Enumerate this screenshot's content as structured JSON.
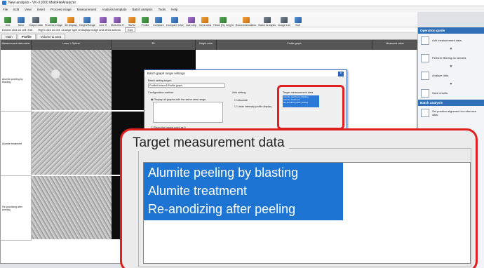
{
  "window": {
    "title": "New analysis - VK-X1000 MultiFileAnalyzer"
  },
  "menu": [
    "File",
    "Edit",
    "View",
    "Insert",
    "Process image",
    "Measurement",
    "Analysis template",
    "Batch analysis",
    "Tools",
    "Help"
  ],
  "ribbon": [
    "Add",
    "Save",
    "Output data",
    "Process image",
    "3D display",
    "Height/Range",
    "Line R",
    "Multi-line R",
    "Sa/Sz",
    "Profile",
    "Compare",
    "Compare CAD",
    "Ave step",
    "Vol & area",
    "Plane (R), height",
    "Recommendation",
    "Batch Analysis",
    "Image List",
    "Sort"
  ],
  "hints": {
    "double": "Double click on cell: Edit",
    "right": "Right click on cell: Change type of display image and other actions",
    "edit": "Edit"
  },
  "tabs": [
    "Main",
    "Profile",
    "Volume & area"
  ],
  "grid": {
    "headers": [
      "Measurement data name",
      "Laser + Optical",
      "3D",
      "Height color",
      "Profile graph",
      "Measured value"
    ],
    "rows": [
      "Alumite peeling by blasting",
      "Alumite treatment",
      "Re-anodizing after peeling"
    ]
  },
  "guide": {
    "title": "Operation guide",
    "steps": [
      "Add measurement data.",
      "Perform filtering as needed.",
      "Analyze data.",
      "Save results."
    ],
    "batch_title": "Batch analysis",
    "batch_step": "Set position alignment for reference data."
  },
  "dialog": {
    "title": "Batch graph range settings",
    "setting_label": "Batch setting target:",
    "setting_value": "Profile/Horizon1/Profile graph",
    "config_label": "Configuration method",
    "option": "Display all graphs with the same view range",
    "lowest": "Show the lowest point as 0",
    "axis_label": "Axis setting",
    "absolute": "Absolute",
    "laser_only": "Laser intensity profile display",
    "target_label": "Target measurement data"
  },
  "zoom": {
    "group_title": "Target measurement data",
    "items": [
      "Alumite peeling by blasting",
      "Alumite treatment",
      "Re-anodizing after peeling"
    ]
  },
  "colors": {
    "highlight": "#1e74d2",
    "callout": "#e02020"
  }
}
